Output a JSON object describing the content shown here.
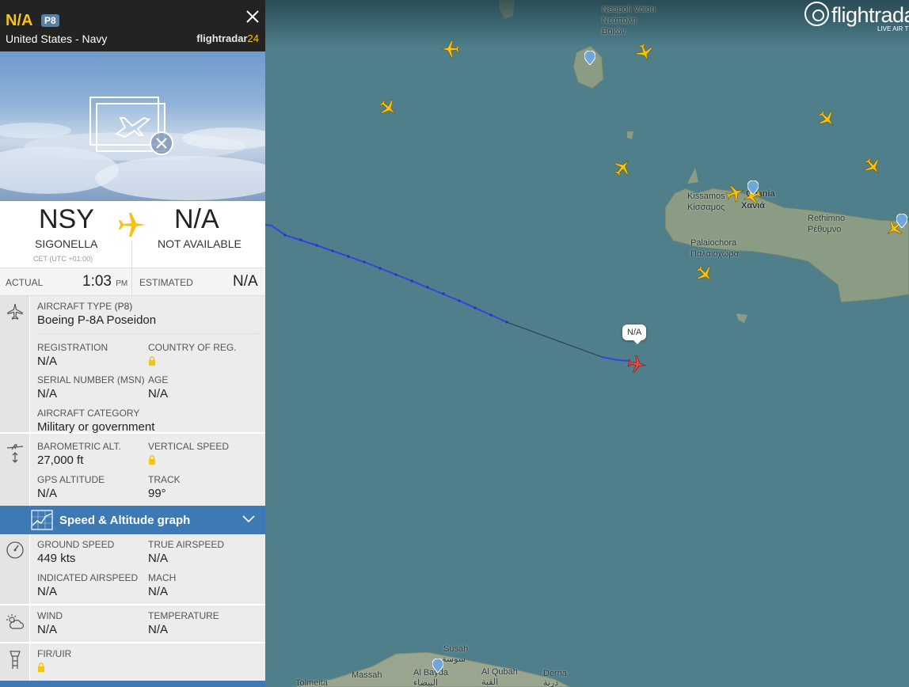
{
  "map": {
    "logo_text": "flightradar",
    "logo_sub": "LIVE AIR TRAFFIC",
    "selected_label": "N/A",
    "labels": {
      "neapoli": "Neapoli Voion",
      "neapoli_gr1": "Νεάπολη",
      "neapoli_gr2": "Βοιών",
      "kissamos": "Kissamos",
      "kissamos_gr": "Κίσσαμος",
      "chania": "Chania",
      "chania_gr": "Χανιά",
      "rethimno": "Rethimno",
      "rethimno_gr": "Ρέθυμνο",
      "palaiochora": "Palaiochora",
      "palaiochora_gr": "Παλαιοχώρα",
      "susah": "Susah",
      "susah_ar": "سوسة",
      "massah": "Massah",
      "albayda": "Al Bayda",
      "albayda_ar": "البيضاء",
      "alqubah": "Al Qubah",
      "alqubah_ar": "القبة",
      "derna": "Derna",
      "derna_ar": "درنة",
      "tolmeita": "Tolmeita"
    }
  },
  "panel": {
    "callsign": "N/A",
    "type_badge": "P8",
    "airline": "United States - Navy",
    "brand": "flightradar",
    "brand_num": "24",
    "origin": {
      "code": "NSY",
      "city": "SIGONELLA",
      "tz": "CET (UTC +01:00)"
    },
    "destination": {
      "code": "N/A",
      "city": "NOT AVAILABLE"
    },
    "times": {
      "actual_label": "ACTUAL",
      "actual_value": "1:03",
      "actual_suffix": "PM",
      "estimated_label": "ESTIMATED",
      "estimated_value": "N/A"
    },
    "aircraft": {
      "type_label": "AIRCRAFT TYPE",
      "type_code": "(P8)",
      "type_value": "Boeing P-8A Poseidon",
      "reg_label": "REGISTRATION",
      "reg_value": "N/A",
      "country_label": "COUNTRY OF REG.",
      "serial_label": "SERIAL NUMBER (MSN)",
      "serial_value": "N/A",
      "age_label": "AGE",
      "age_value": "N/A",
      "category_label": "AIRCRAFT CATEGORY",
      "category_value": "Military or government"
    },
    "altitude": {
      "baro_label": "BAROMETRIC ALT.",
      "baro_value": "27,000 ft",
      "vs_label": "VERTICAL SPEED",
      "gps_label": "GPS ALTITUDE",
      "gps_value": "N/A",
      "track_label": "TRACK",
      "track_value": "99°"
    },
    "graph_label": "Speed & Altitude graph",
    "speed": {
      "gs_label": "GROUND SPEED",
      "gs_value": "449 kts",
      "tas_label": "TRUE AIRSPEED",
      "tas_value": "N/A",
      "ias_label": "INDICATED AIRSPEED",
      "ias_value": "N/A",
      "mach_label": "MACH",
      "mach_value": "N/A"
    },
    "weather": {
      "wind_label": "WIND",
      "wind_value": "N/A",
      "temp_label": "TEMPERATURE",
      "temp_value": "N/A"
    },
    "fir": {
      "fir_label": "FIR/UIR"
    }
  },
  "colors": {
    "accent": "#f6c315",
    "header_bg": "#232323",
    "graph_bar": "#3d79b5",
    "map_sea": "#4e7f8b",
    "track_line": "#3344dd",
    "selected_plane": "#e84a4a"
  },
  "icons": [
    "close-icon",
    "plane-icon",
    "aircraft-type-icon",
    "altitude-icon",
    "graph-icon",
    "chevron-down-icon",
    "speedometer-icon",
    "weather-icon",
    "tower-icon",
    "lock-icon",
    "location-pin-icon",
    "no-photo-icon"
  ]
}
